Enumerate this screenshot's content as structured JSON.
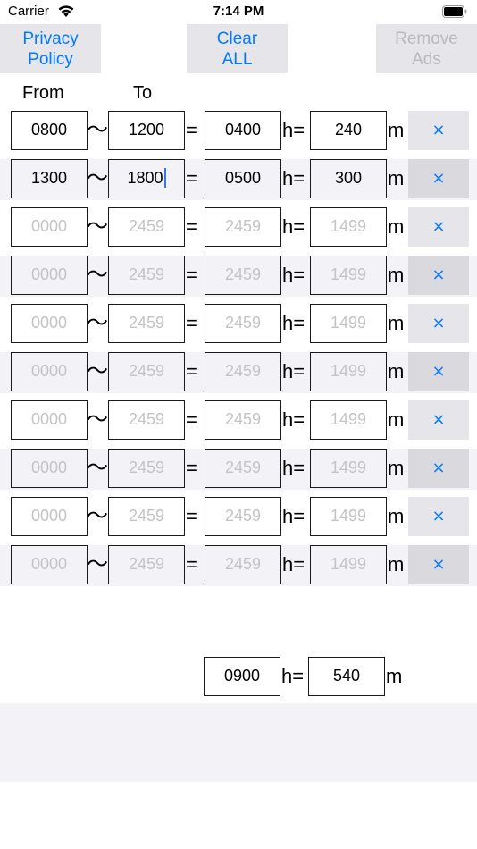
{
  "status_bar": {
    "carrier": "Carrier",
    "wifi_icon": "wifi-icon",
    "time": "7:14 PM",
    "battery_icon": "battery-full-icon"
  },
  "toolbar": {
    "privacy_label": "Privacy\nPolicy",
    "clear_label": "Clear\nALL",
    "remove_ads_label": "Remove\nAds",
    "remove_ads_enabled": false
  },
  "colors": {
    "accent": "#007aff",
    "button_bg": "#e5e5ea",
    "alt_row_bg": "#f2f2f7",
    "placeholder": "#c4c4c7",
    "disabled_text": "#b9b9bd"
  },
  "headers": {
    "from": "From",
    "to": "To"
  },
  "symbols": {
    "tilde": "〜",
    "equals": "=",
    "hours": "h=",
    "minutes": "m",
    "delete": "×"
  },
  "rows": [
    {
      "from": "0800",
      "to": "1200",
      "diff": "0400",
      "minutes": "240",
      "placeholder": false
    },
    {
      "from": "1300",
      "to": "1800",
      "diff": "0500",
      "minutes": "300",
      "placeholder": false,
      "focused": "to"
    },
    {
      "from": "0000",
      "to": "2459",
      "diff": "2459",
      "minutes": "1499",
      "placeholder": true
    },
    {
      "from": "0000",
      "to": "2459",
      "diff": "2459",
      "minutes": "1499",
      "placeholder": true
    },
    {
      "from": "0000",
      "to": "2459",
      "diff": "2459",
      "minutes": "1499",
      "placeholder": true
    },
    {
      "from": "0000",
      "to": "2459",
      "diff": "2459",
      "minutes": "1499",
      "placeholder": true
    },
    {
      "from": "0000",
      "to": "2459",
      "diff": "2459",
      "minutes": "1499",
      "placeholder": true
    },
    {
      "from": "0000",
      "to": "2459",
      "diff": "2459",
      "minutes": "1499",
      "placeholder": true
    },
    {
      "from": "0000",
      "to": "2459",
      "diff": "2459",
      "minutes": "1499",
      "placeholder": true
    },
    {
      "from": "0000",
      "to": "2459",
      "diff": "2459",
      "minutes": "1499",
      "placeholder": true
    }
  ],
  "total": {
    "hours": "0900",
    "minutes": "540"
  }
}
